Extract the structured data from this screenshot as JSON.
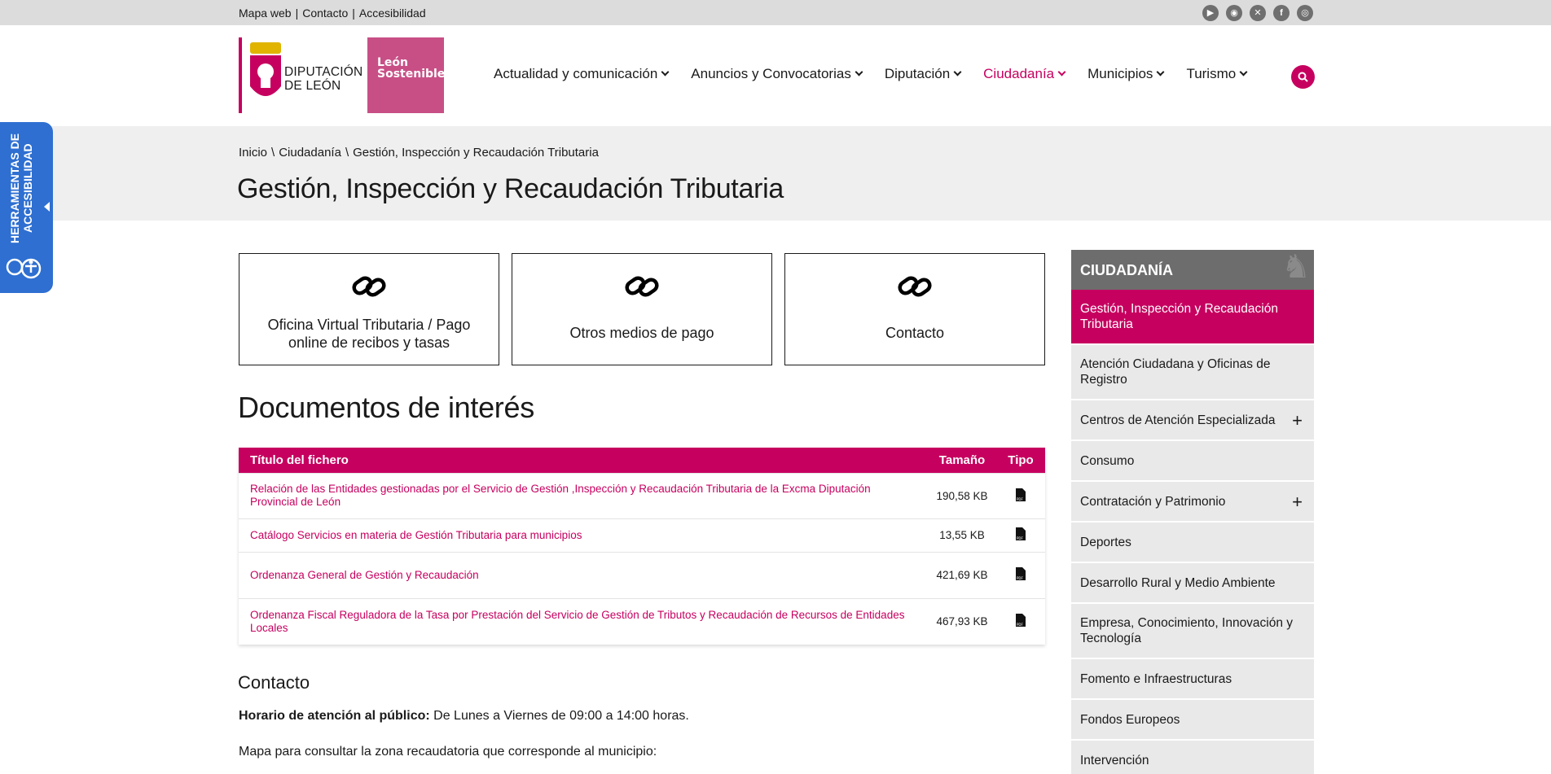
{
  "topbar": {
    "links": [
      "Mapa web",
      "Contacto",
      "Accesibilidad"
    ],
    "social_icons": [
      "youtube-icon",
      "rss-icon",
      "x-icon",
      "facebook-icon",
      "instagram-icon"
    ]
  },
  "header": {
    "logo_text_line1": "DIPUTACIÓN",
    "logo_text_line2": "DE LEÓN",
    "logo2_line1": "León",
    "logo2_line2": "Sostenible",
    "nav": [
      {
        "label": "Actualidad y comunicación",
        "active": false
      },
      {
        "label": "Anuncios y Convocatorias",
        "active": false
      },
      {
        "label": "Diputación",
        "active": false
      },
      {
        "label": "Ciudadanía",
        "active": true
      },
      {
        "label": "Municipios",
        "active": false
      },
      {
        "label": "Turismo",
        "active": false
      }
    ]
  },
  "accessibility_tab": {
    "label": "HERRAMIENTAS DE ACCESIBILIDAD"
  },
  "breadcrumb": [
    "Inicio",
    "Ciudadanía",
    "Gestión, Inspección y Recaudación Tributaria"
  ],
  "page_title": "Gestión, Inspección y Recaudación Tributaria",
  "cards": [
    {
      "label": "Oficina Virtual Tributaria / Pago online de recibos y tasas"
    },
    {
      "label": "Otros medios de pago"
    },
    {
      "label": "Contacto"
    }
  ],
  "documents": {
    "heading": "Documentos de interés",
    "columns": [
      "Título del fichero",
      "Tamaño",
      "Tipo"
    ],
    "rows": [
      {
        "title": "Relación de las Entidades gestionadas por el Servicio de Gestión ,Inspección y Recaudación Tributaria de la Excma Diputación Provincial de León",
        "size": "190,58 KB",
        "type": "PDF"
      },
      {
        "title": "Catálogo Servicios en materia de Gestión Tributaria para municipios",
        "size": "13,55 KB",
        "type": "PDF"
      },
      {
        "title": "Ordenanza General de Gestión y Recaudación",
        "size": "421,69 KB",
        "type": "PDF"
      },
      {
        "title": "Ordenanza Fiscal Reguladora de la Tasa por Prestación del Servicio de Gestión de Tributos y Recaudación de Recursos de Entidades Locales",
        "size": "467,93 KB",
        "type": "PDF"
      }
    ]
  },
  "contact": {
    "heading": "Contacto",
    "horario_label": "Horario de atención al público:",
    "horario_value": " De Lunes a Viernes de 09:00 a 14:00 horas.",
    "mapa_text": "Mapa para consultar la zona recaudatoria que corresponde al municipio:"
  },
  "sidebar": {
    "title": "CIUDADANÍA",
    "items": [
      {
        "label": "Gestión, Inspección y Recaudación Tributaria",
        "active": true,
        "expandable": false
      },
      {
        "label": "Atención Ciudadana y Oficinas de Registro",
        "active": false,
        "expandable": false
      },
      {
        "label": "Centros de Atención Especializada",
        "active": false,
        "expandable": true
      },
      {
        "label": "Consumo",
        "active": false,
        "expandable": false
      },
      {
        "label": "Contratación y Patrimonio",
        "active": false,
        "expandable": true
      },
      {
        "label": "Deportes",
        "active": false,
        "expandable": false
      },
      {
        "label": "Desarrollo Rural y Medio Ambiente",
        "active": false,
        "expandable": false
      },
      {
        "label": "Empresa, Conocimiento, Innovación y Tecnología",
        "active": false,
        "expandable": false
      },
      {
        "label": "Fomento e Infraestructuras",
        "active": false,
        "expandable": false
      },
      {
        "label": "Fondos Europeos",
        "active": false,
        "expandable": false
      },
      {
        "label": "Intervención",
        "active": false,
        "expandable": false
      }
    ]
  },
  "colors": {
    "brand": "#c6005f",
    "sidebar_head": "#6d6d6d",
    "accessibility": "#2e6fd1"
  }
}
